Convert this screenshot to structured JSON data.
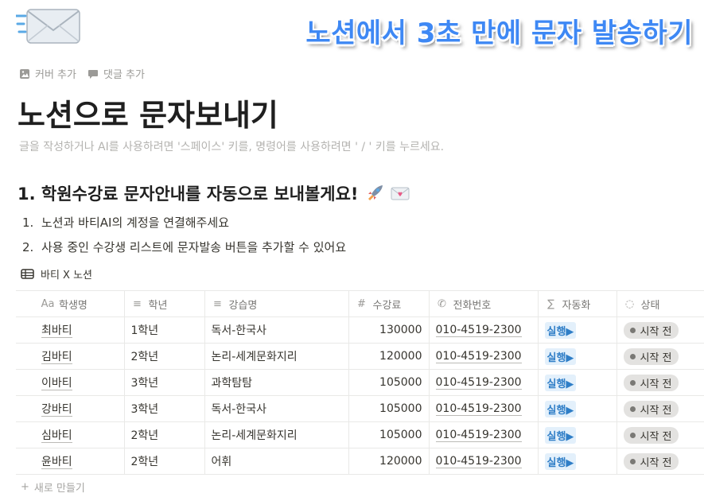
{
  "banner": "노션에서 3초 만에 문자 발송하기",
  "meta": {
    "add_cover": "커버 추가",
    "add_comment": "댓글 추가"
  },
  "title": "노션으로 문자보내기",
  "placeholder": "글을 작성하거나 AI를 사용하려면 '스페이스' 키를, 명령어를 사용하려면 ' / ' 키를 누르세요.",
  "heading": "1. 학원수강료 문자안내를 자동으로 보내볼게요!",
  "steps": [
    {
      "num": "1.",
      "text": "노션과 바티AI의 계정을 연결해주세요"
    },
    {
      "num": "2.",
      "text": "사용 중인 수강생 리스트에 문자발송 버튼을 추가할 수 있어요"
    }
  ],
  "database": {
    "title": "바티 X 노션",
    "columns": [
      {
        "icon": "Aa",
        "label": "학생명"
      },
      {
        "icon": "≡",
        "label": "학년"
      },
      {
        "icon": "≡",
        "label": "강습명"
      },
      {
        "icon": "#",
        "label": "수강료"
      },
      {
        "icon": "✆",
        "label": "전화번호"
      },
      {
        "icon": "∑",
        "label": "자동화"
      },
      {
        "icon": "◌",
        "label": "상태"
      }
    ],
    "rows": [
      {
        "name": "최바티",
        "grade": "1학년",
        "course": "독서-한국사",
        "fee": "130000",
        "phone": "010-4519-2300",
        "action": "실행▶",
        "status": "시작 전"
      },
      {
        "name": "김바티",
        "grade": "2학년",
        "course": "논리-세계문화지리",
        "fee": "120000",
        "phone": "010-4519-2300",
        "action": "실행▶",
        "status": "시작 전"
      },
      {
        "name": "이바티",
        "grade": "3학년",
        "course": "과학탐탐",
        "fee": "105000",
        "phone": "010-4519-2300",
        "action": "실행▶",
        "status": "시작 전"
      },
      {
        "name": "강바티",
        "grade": "3학년",
        "course": "독서-한국사",
        "fee": "105000",
        "phone": "010-4519-2300",
        "action": "실행▶",
        "status": "시작 전"
      },
      {
        "name": "심바티",
        "grade": "2학년",
        "course": "논리-세계문화지리",
        "fee": "105000",
        "phone": "010-4519-2300",
        "action": "실행▶",
        "status": "시작 전"
      },
      {
        "name": "윤바티",
        "grade": "2학년",
        "course": "어휘",
        "fee": "120000",
        "phone": "010-4519-2300",
        "action": "실행▶",
        "status": "시작 전"
      }
    ],
    "new_row": "새로 만들기"
  },
  "colors": {
    "banner": "#3e88f4",
    "button_bg": "#e3f0fb",
    "button_text": "#2f7ec7",
    "status_bg": "#e3e2e0"
  }
}
